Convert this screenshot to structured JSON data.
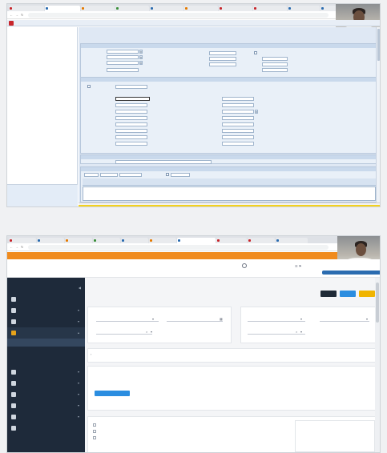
{
  "shot1": {
    "tabs": [
      "",
      "",
      "",
      "",
      "",
      "",
      "",
      "",
      "",
      ""
    ],
    "url": "",
    "erp": {
      "path": "",
      "user": "",
      "tree": [
        "",
        "",
        "",
        "",
        "",
        "",
        "",
        ""
      ],
      "bottom_links": [
        "",
        "",
        ""
      ],
      "sections": {
        "top": "",
        "top_right": "",
        "address": "",
        "grid_title": "",
        "grid_sub": ""
      }
    }
  },
  "shot2": {
    "tabs": [
      "",
      "",
      "",
      "",
      "",
      "",
      "",
      "",
      "",
      ""
    ],
    "url": "",
    "banner": "",
    "app_title": "",
    "user": "",
    "breadcrumb": "",
    "buttons": [
      {
        "label": "",
        "color": "#1f2a37"
      },
      {
        "label": "",
        "color": "#2b8de0"
      },
      {
        "label": "",
        "color": "#f0b400"
      }
    ],
    "nav": [
      "",
      "",
      "",
      "",
      "",
      "",
      "",
      "",
      ""
    ],
    "nav_sub": [
      "",
      "",
      ""
    ],
    "section_label": "",
    "table_headers": [
      "",
      "",
      "",
      "",
      "",
      "",
      "",
      "",
      "",
      ""
    ],
    "add_button": "",
    "footer_checks": [
      "",
      "",
      ""
    ],
    "footer_right": [
      "",
      ""
    ]
  },
  "colors": {
    "erp_logo": "#c8262c",
    "banner": "#f08a1c",
    "sidebar": "#1e2a3a",
    "accent_yellow": "#f3d21f"
  }
}
